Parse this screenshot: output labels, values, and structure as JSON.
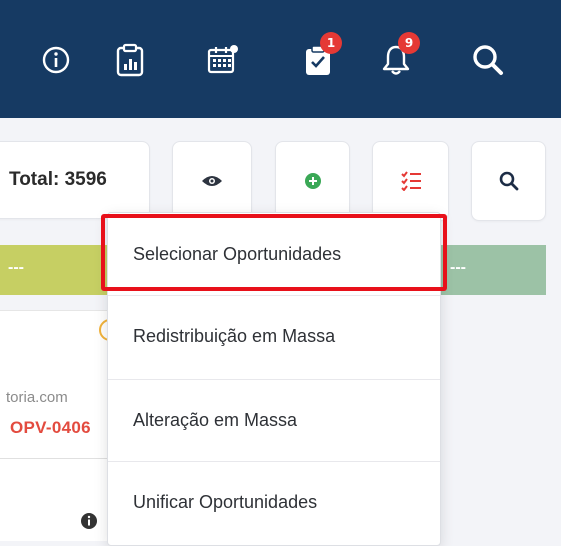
{
  "topbar": {
    "icons": {
      "info": "info-icon",
      "report": "clipboard-chart-icon",
      "calendar": "calendar-icon",
      "tasks": "clipboard-check-icon",
      "notifications": "bell-icon",
      "search": "search-icon"
    },
    "tasks_badge": "1",
    "notifications_badge": "9",
    "background_color": "#163a63"
  },
  "toolbar": {
    "total_label": "Total: 3596",
    "view_icon": "eye-icon",
    "add_icon": "plus-circle-icon",
    "list_icon": "checklist-icon",
    "search_icon": "search-icon"
  },
  "columns": {
    "left_band_text": "---",
    "right_band_text": "---",
    "left_band_color": "#c6cf63",
    "right_band_color": "#9cc2a6"
  },
  "left_card": {
    "email_fragment": "toria.com",
    "opv_fragment": "OPV-0406"
  },
  "dropdown": {
    "items": [
      {
        "label": "Selecionar Oportunidades"
      },
      {
        "label": "Redistribuição em Massa"
      },
      {
        "label": "Alteração em Massa"
      },
      {
        "label": "Unificar Oportunidades"
      }
    ],
    "highlight_color": "#e8101a"
  }
}
